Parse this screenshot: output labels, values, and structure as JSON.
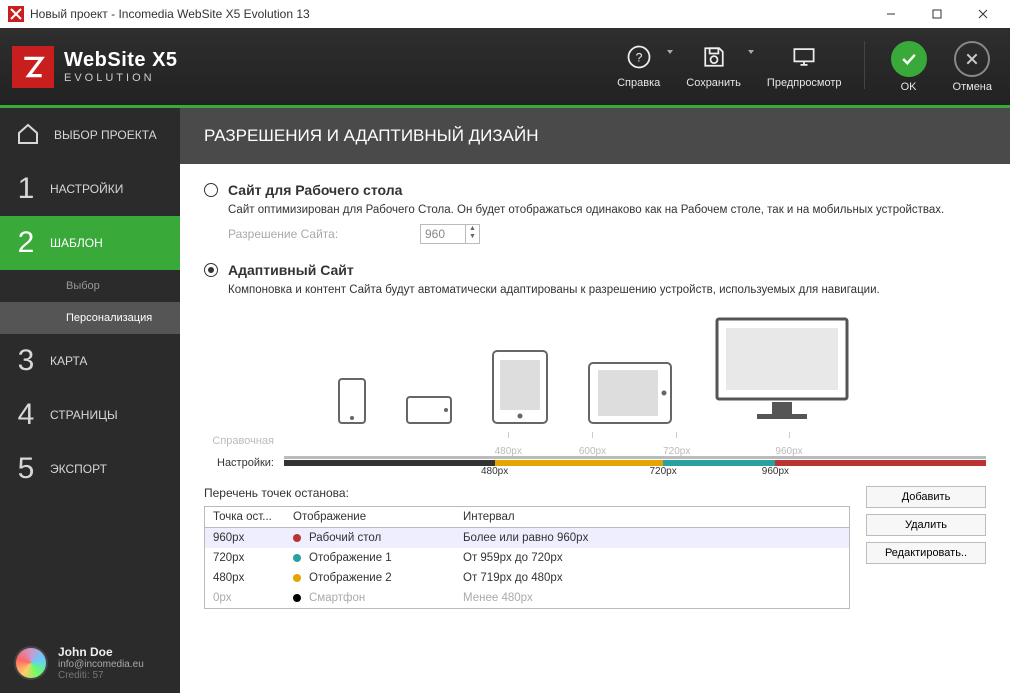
{
  "window": {
    "title": "Новый проект - Incomedia WebSite X5 Evolution 13"
  },
  "logo": {
    "name": "WebSite X5",
    "edition": "EVOLUTION"
  },
  "header_actions": {
    "help": "Справка",
    "save": "Сохранить",
    "preview": "Предпросмотр",
    "ok": "OK",
    "cancel": "Отмена"
  },
  "sidebar": {
    "project": "ВЫБОР ПРОЕКТА",
    "step1": "НАСТРОЙКИ",
    "step2": "ШАБЛОН",
    "step2_sub_a": "Выбор",
    "step2_sub_b": "Персонализация",
    "step3": "КАРТА",
    "step4": "СТРАНИЦЫ",
    "step5": "ЭКСПОРТ"
  },
  "user": {
    "name": "John Doe",
    "email": "info@incomedia.eu",
    "credit": "Crediti: 57"
  },
  "page": {
    "title": "РАЗРЕШЕНИЯ И АДАПТИВНЫЙ ДИЗАЙН"
  },
  "desktop_option": {
    "title": "Сайт для Рабочего стола",
    "desc": "Сайт оптимизирован для Рабочего Стола. Он будет отображаться одинаково как на Рабочем столе, так и на мобильных устройствах.",
    "res_label": "Разрешение Сайта:",
    "res_value": "960"
  },
  "responsive_option": {
    "title": "Адаптивный Сайт",
    "desc": "Компоновка и контент Сайта будут автоматически адаптированы к разрешению устройств, используемых для навигации."
  },
  "reference": {
    "label": "Справочная",
    "ticks": [
      "480px",
      "600px",
      "720px",
      "960px"
    ]
  },
  "settings_axis": {
    "label": "Настройки:",
    "labels": [
      "480px",
      "720px",
      "960px"
    ]
  },
  "bp": {
    "heading": "Перечень точек останова:",
    "cols": {
      "size": "Точка ост...",
      "display": "Отображение",
      "range": "Интервал"
    },
    "rows": [
      {
        "size": "960px",
        "dot": "red",
        "display": "Рабочий стол",
        "range": "Более или равно 960px",
        "sel": true
      },
      {
        "size": "720px",
        "dot": "teal",
        "display": "Отображение 1",
        "range": "От 959px до 720px"
      },
      {
        "size": "480px",
        "dot": "yellow",
        "display": "Отображение 2",
        "range": "От 719px до 480px"
      },
      {
        "size": "0px",
        "dot": "black",
        "display": "Смартфон",
        "range": "Менее 480px",
        "dis": true
      }
    ],
    "buttons": {
      "add": "Добавить",
      "del": "Удалить",
      "edit": "Редактировать.."
    }
  }
}
